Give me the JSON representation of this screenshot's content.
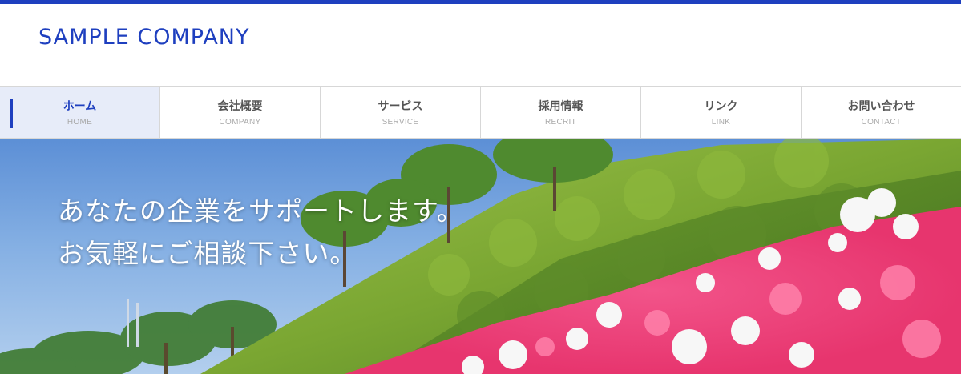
{
  "header": {
    "logo_text": "SAMPLE COMPANY",
    "accent_color": "#1e3fbf"
  },
  "nav": {
    "items": [
      {
        "label": "ホーム",
        "sub": "HOME",
        "active": true
      },
      {
        "label": "会社概要",
        "sub": "COMPANY",
        "active": false
      },
      {
        "label": "サービス",
        "sub": "SERVICE",
        "active": false
      },
      {
        "label": "採用情報",
        "sub": "RECRIT",
        "active": false
      },
      {
        "label": "リンク",
        "sub": "LINK",
        "active": false
      },
      {
        "label": "お問い合わせ",
        "sub": "CONTACT",
        "active": false
      }
    ]
  },
  "hero": {
    "line1": "あなたの企業をサポートします。",
    "line2": "お気軽にご相談下さい。",
    "image_subject": "hillside-azalea-flowers-photo"
  }
}
